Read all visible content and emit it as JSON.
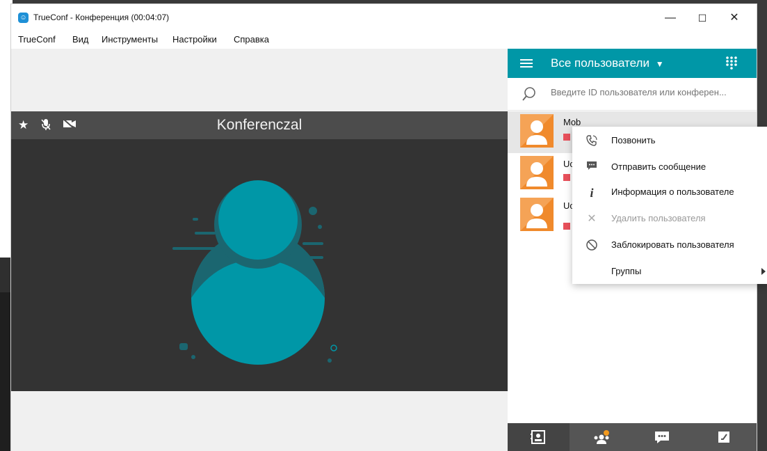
{
  "window": {
    "title": "TrueConf - Конференция (00:04:07)",
    "controls": {
      "minimize": "—",
      "maximize": "☐",
      "close": "✕"
    }
  },
  "menubar": [
    "TrueConf",
    "Вид",
    "Инструменты",
    "Настройки",
    "Справка"
  ],
  "video": {
    "title": "Konferenczal",
    "header_icons": [
      "star-icon",
      "mic-muted-icon",
      "camera-off-icon"
    ],
    "colors": {
      "header": "#4c4c4c",
      "body": "#333333",
      "avatar": "#0097a7",
      "avatar_shadow": "#1b6670"
    }
  },
  "panel": {
    "title": "Все пользователи",
    "search_placeholder": "Введите ID пользователя или конферен...",
    "accent": "#0097a7",
    "users": [
      {
        "name": "Mob",
        "status_color": "#e8505b",
        "selected": true
      },
      {
        "name": "Uch",
        "status_color": "#e8505b",
        "selected": false
      },
      {
        "name": "Uch",
        "status_color": "#e8505b",
        "selected": false
      }
    ],
    "footer_tabs": [
      "contacts-icon",
      "conferences-icon",
      "chat-icon",
      "settings-icon"
    ]
  },
  "context_menu": {
    "items": [
      {
        "label": "Позвонить",
        "icon": "phone-icon",
        "enabled": true
      },
      {
        "label": "Отправить сообщение",
        "icon": "message-icon",
        "enabled": true
      },
      {
        "label": "Информация о пользователе",
        "icon": "info-icon",
        "enabled": true
      },
      {
        "label": "Удалить пользователя",
        "icon": "delete-icon",
        "enabled": false
      },
      {
        "label": "Заблокировать пользователя",
        "icon": "block-icon",
        "enabled": true
      },
      {
        "label": "Группы",
        "icon": "",
        "enabled": true,
        "submenu": true
      }
    ]
  }
}
